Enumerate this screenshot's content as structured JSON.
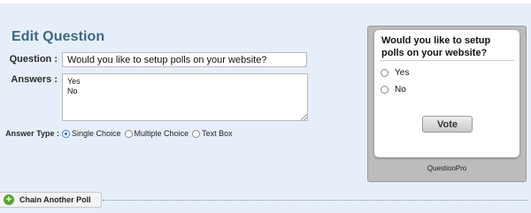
{
  "title": "Edit Question",
  "form": {
    "question_label": "Question :",
    "question_value": "Would you like to setup polls on your website?",
    "answers_label": "Answers :",
    "answers_value": "Yes\nNo",
    "answer_type_label": "Answer Type :",
    "answer_types": [
      {
        "label": "Single Choice",
        "selected": true
      },
      {
        "label": "Multiple Choice",
        "selected": false
      },
      {
        "label": "Text Box",
        "selected": false
      }
    ]
  },
  "poll": {
    "question": "Would you like to setup polls on your website?",
    "options": [
      "Yes",
      "No"
    ],
    "vote_label": "Vote",
    "brand": "QuestionPro"
  },
  "chain": {
    "label": "Chain Another Poll",
    "icon": "plus-circle-icon"
  },
  "colors": {
    "background": "#e6eff9",
    "title": "#3f6786",
    "add_icon": "#5aa531"
  }
}
